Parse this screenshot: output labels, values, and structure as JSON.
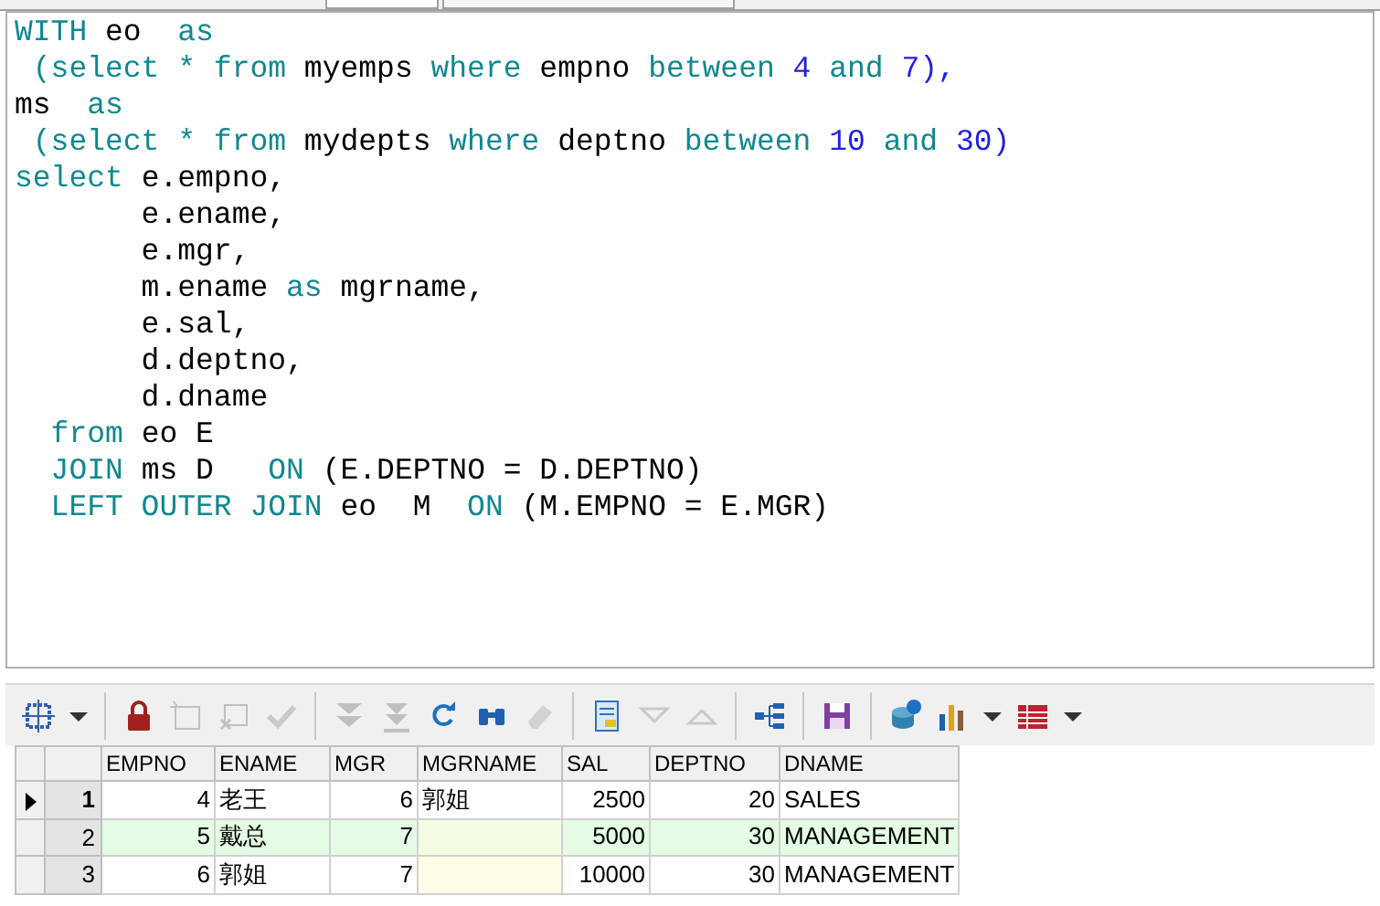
{
  "editor": {
    "lines": [
      [
        {
          "t": "WITH",
          "kind": "keyword"
        },
        {
          "t": " eo  ",
          "kind": "ident"
        },
        {
          "t": "as",
          "kind": "keyword"
        }
      ],
      [
        {
          "t": " (select * from",
          "kind": "keyword"
        },
        {
          "t": " myemps ",
          "kind": "ident"
        },
        {
          "t": "where",
          "kind": "keyword"
        },
        {
          "t": " empno ",
          "kind": "ident"
        },
        {
          "t": "between ",
          "kind": "keyword"
        },
        {
          "t": "4",
          "kind": "number"
        },
        {
          "t": " and ",
          "kind": "keyword"
        },
        {
          "t": "7),",
          "kind": "number"
        }
      ],
      [
        {
          "t": "ms  ",
          "kind": "ident"
        },
        {
          "t": "as",
          "kind": "keyword"
        }
      ],
      [
        {
          "t": " (select * from",
          "kind": "keyword"
        },
        {
          "t": " mydepts ",
          "kind": "ident"
        },
        {
          "t": "where",
          "kind": "keyword"
        },
        {
          "t": " deptno ",
          "kind": "ident"
        },
        {
          "t": "between ",
          "kind": "keyword"
        },
        {
          "t": "10",
          "kind": "number"
        },
        {
          "t": " and ",
          "kind": "keyword"
        },
        {
          "t": "30)",
          "kind": "number"
        }
      ],
      [
        {
          "t": "select",
          "kind": "keyword"
        },
        {
          "t": " e.empno,",
          "kind": "ident"
        }
      ],
      [
        {
          "t": "       e.ename,",
          "kind": "ident"
        }
      ],
      [
        {
          "t": "       e.mgr,",
          "kind": "ident"
        }
      ],
      [
        {
          "t": "       m.ename ",
          "kind": "ident"
        },
        {
          "t": "as",
          "kind": "keyword"
        },
        {
          "t": " mgrname,",
          "kind": "ident"
        }
      ],
      [
        {
          "t": "       e.sal,",
          "kind": "ident"
        }
      ],
      [
        {
          "t": "       d.deptno,",
          "kind": "ident"
        }
      ],
      [
        {
          "t": "       d.dname",
          "kind": "ident"
        }
      ],
      [
        {
          "t": "  from",
          "kind": "keyword"
        },
        {
          "t": " eo E",
          "kind": "ident"
        }
      ],
      [
        {
          "t": "  JOIN",
          "kind": "keyword"
        },
        {
          "t": " ms D   ",
          "kind": "ident"
        },
        {
          "t": "ON",
          "kind": "keyword"
        },
        {
          "t": " (E.DEPTNO = D.DEPTNO)",
          "kind": "ident"
        }
      ],
      [
        {
          "t": "  LEFT OUTER JOIN",
          "kind": "keyword"
        },
        {
          "t": " eo  M  ",
          "kind": "ident"
        },
        {
          "t": "ON",
          "kind": "keyword"
        },
        {
          "t": " (M.EMPNO = E.MGR)",
          "kind": "ident"
        }
      ]
    ]
  },
  "toolbar": [
    {
      "kind": "select-grid",
      "disabled": false
    },
    {
      "kind": "caret",
      "disabled": false
    },
    {
      "kind": "sep"
    },
    {
      "kind": "lock",
      "disabled": false
    },
    {
      "kind": "new-record",
      "disabled": true
    },
    {
      "kind": "delete-record",
      "disabled": true
    },
    {
      "kind": "check",
      "disabled": true
    },
    {
      "kind": "sep"
    },
    {
      "kind": "fetch-next",
      "disabled": true
    },
    {
      "kind": "fetch-all",
      "disabled": true
    },
    {
      "kind": "refresh",
      "disabled": false
    },
    {
      "kind": "find",
      "disabled": false
    },
    {
      "kind": "eraser",
      "disabled": true
    },
    {
      "kind": "sep"
    },
    {
      "kind": "form",
      "disabled": false
    },
    {
      "kind": "down",
      "disabled": true
    },
    {
      "kind": "up",
      "disabled": true
    },
    {
      "kind": "sep"
    },
    {
      "kind": "tree",
      "disabled": false
    },
    {
      "kind": "sep"
    },
    {
      "kind": "save",
      "disabled": false
    },
    {
      "kind": "sep"
    },
    {
      "kind": "export",
      "disabled": false
    },
    {
      "kind": "chart",
      "disabled": false
    },
    {
      "kind": "caret",
      "disabled": false
    },
    {
      "kind": "table",
      "disabled": false
    },
    {
      "kind": "caret",
      "disabled": false
    }
  ],
  "grid": {
    "columns": [
      "EMPNO",
      "ENAME",
      "MGR",
      "MGRNAME",
      "SAL",
      "DEPTNO",
      "DNAME"
    ],
    "rows": [
      {
        "number": "1",
        "selected": true,
        "alternate": false,
        "cells": [
          "4",
          "老王",
          "6",
          "郭姐",
          "2500",
          "20",
          "SALES"
        ]
      },
      {
        "number": "2",
        "selected": false,
        "alternate": true,
        "cells": [
          "5",
          "戴总",
          "7",
          null,
          "5000",
          "30",
          "MANAGEMENT"
        ]
      },
      {
        "number": "3",
        "selected": false,
        "alternate": false,
        "cells": [
          "6",
          "郭姐",
          "7",
          null,
          "10000",
          "30",
          "MANAGEMENT"
        ]
      }
    ]
  }
}
